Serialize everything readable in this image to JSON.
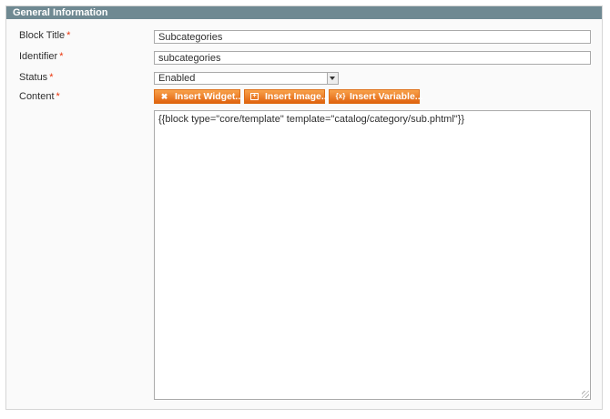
{
  "section": {
    "title": "General Information"
  },
  "fields": {
    "block_title": {
      "label": "Block Title",
      "value": "Subcategories"
    },
    "identifier": {
      "label": "Identifier",
      "value": "subcategories"
    },
    "status": {
      "label": "Status",
      "selected": "Enabled"
    },
    "content": {
      "label": "Content",
      "value": "{{block type=\"core/template\" template=\"catalog/category/sub.phtml\"}}"
    }
  },
  "required_marker": "*",
  "buttons": {
    "insert_widget": "Insert Widget...",
    "insert_image": "Insert Image...",
    "insert_variable": "Insert Variable..."
  },
  "icons": {
    "widget": "widget-icon",
    "image": "image-icon",
    "variable": "variable-icon",
    "variable_glyph": "{x}"
  },
  "colors": {
    "header_bar": "#6f8992",
    "button_orange": "#f18200",
    "required": "#eb340a"
  }
}
